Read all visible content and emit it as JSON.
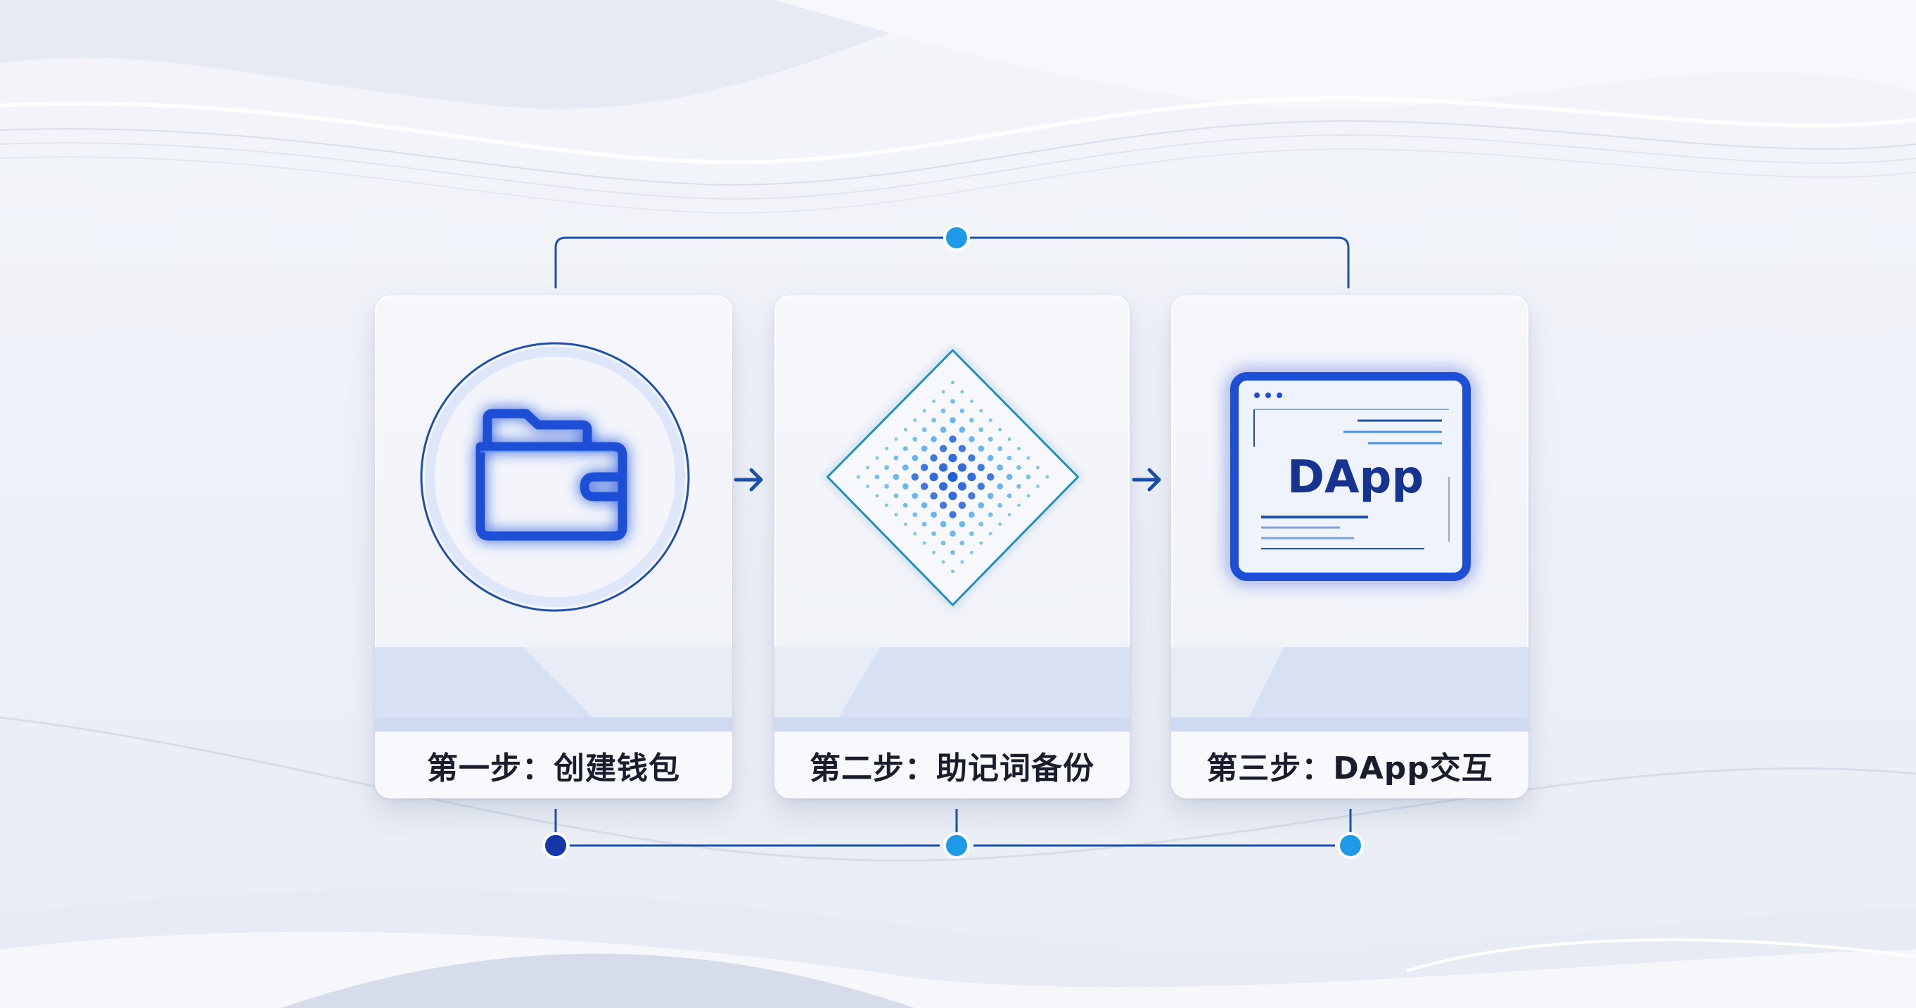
{
  "steps": [
    {
      "id": "step1",
      "label": "第一步：创建钱包",
      "icon": "wallet-icon"
    },
    {
      "id": "step2",
      "label": "第二步：助记词备份",
      "icon": "mnemonic-diamond-icon"
    },
    {
      "id": "step3",
      "label": "第三步：DApp交互",
      "icon": "dapp-window-icon",
      "icon_text": "DApp"
    }
  ],
  "colors": {
    "primary": "#1f4fd6",
    "primary_dark": "#1537a8",
    "accent_dot": "#1e9be8",
    "connector": "#1a4fa8",
    "background": "#eef1f7"
  }
}
